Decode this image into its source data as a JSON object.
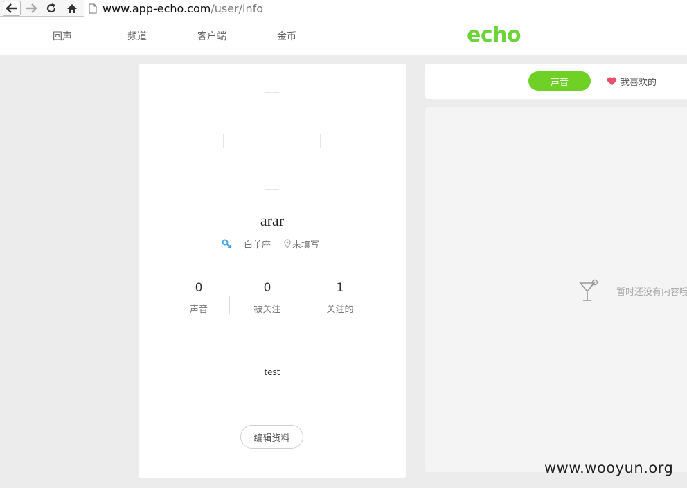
{
  "browser": {
    "url_host": "www.app-echo.com",
    "url_path": "/user/info"
  },
  "header": {
    "nav": [
      "回声",
      "频道",
      "客户端",
      "金币"
    ],
    "logo": "echo",
    "brand_color": "#6cd33b"
  },
  "profile": {
    "username": "arar",
    "zodiac": "白羊座",
    "location": "未填写",
    "stats": [
      {
        "value": "0",
        "label": "声音"
      },
      {
        "value": "0",
        "label": "被关注"
      },
      {
        "value": "1",
        "label": "关注的"
      }
    ],
    "bio": "test",
    "edit_label": "编辑资料"
  },
  "tabs": {
    "voice": "声音",
    "likes": "我喜欢的",
    "active_color": "#6fd126",
    "heart_color": "#e8506a"
  },
  "content": {
    "empty_text": "暂时还没有内容哦"
  },
  "watermark": "www.wooyun.org"
}
